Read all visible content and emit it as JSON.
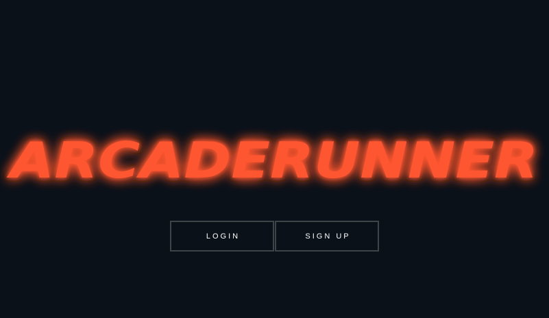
{
  "app": {
    "title": "ARCADERUNNER"
  },
  "colors": {
    "background": "#0a1119",
    "logo": "#ff5630",
    "logo_glow": "#ff2a10",
    "button_border": "#3f4448",
    "button_text": "#ffffff"
  },
  "auth": {
    "login_label": "LOGIN",
    "signup_label": "SIGN UP"
  }
}
